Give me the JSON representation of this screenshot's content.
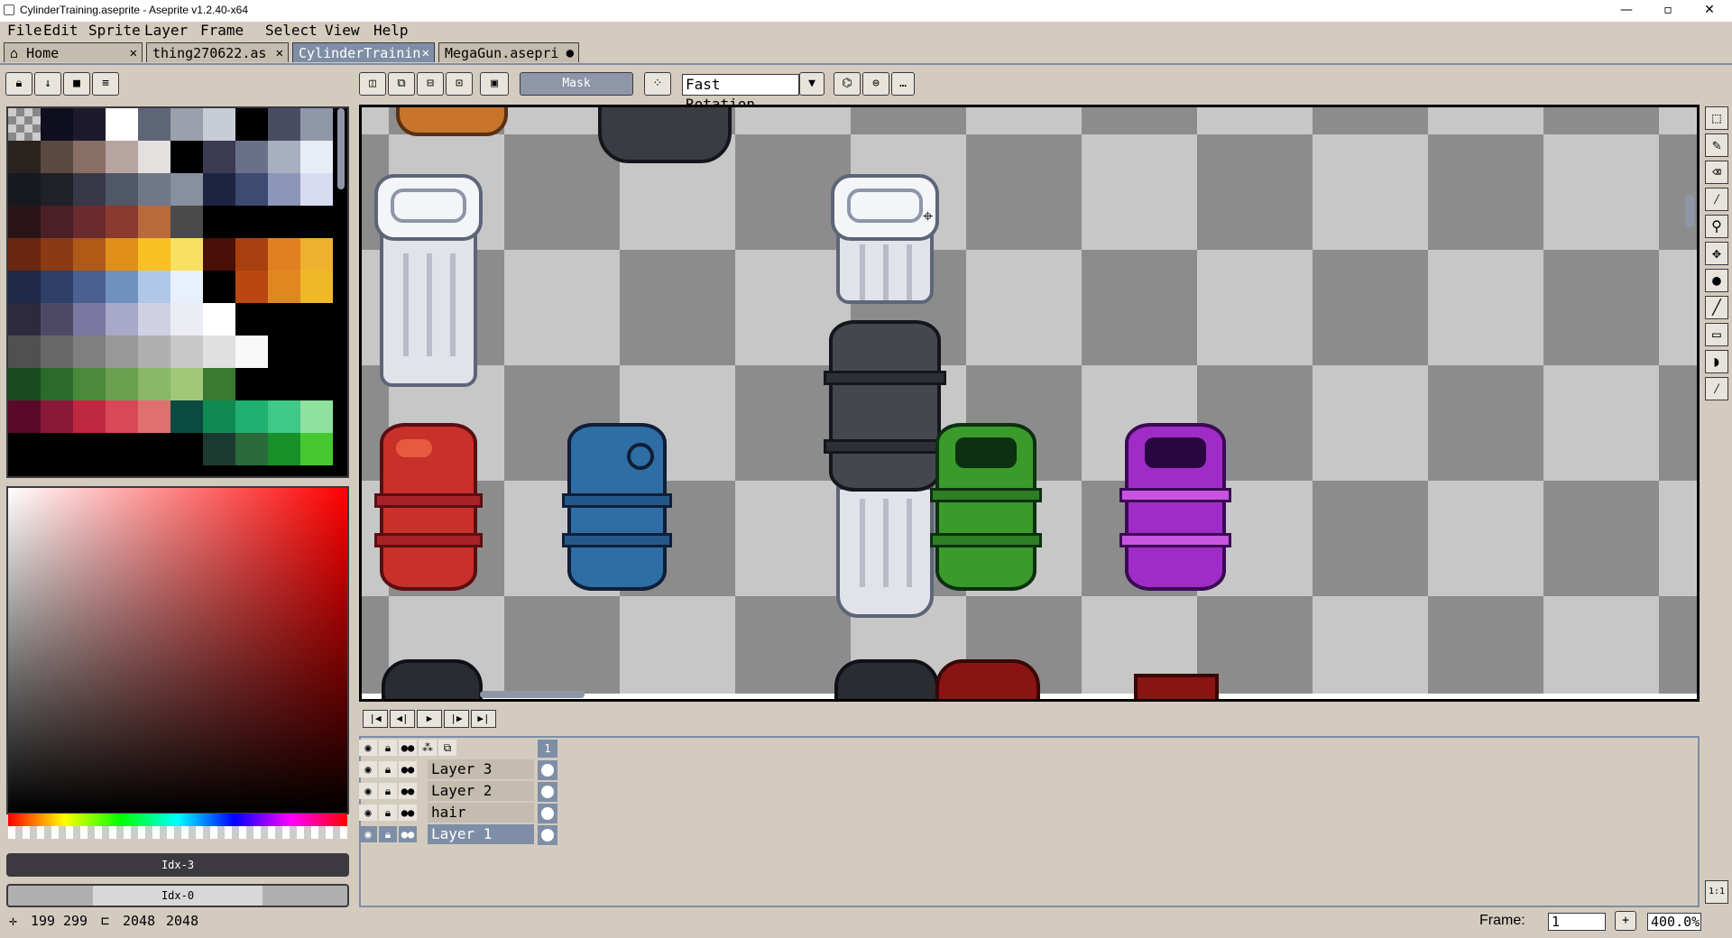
{
  "window": {
    "title": "CylinderTraining.aseprite - Aseprite v1.2.40-x64"
  },
  "menu": [
    "File",
    "Edit",
    "Sprite",
    "Layer",
    "Frame",
    "Select",
    "View",
    "Help"
  ],
  "tabs": [
    {
      "label": "Home",
      "close": "✕"
    },
    {
      "label": "thing270622.as",
      "close": "✕"
    },
    {
      "label": "CylinderTrainin",
      "close": "✕"
    },
    {
      "label": "MegaGun.asepri",
      "close": "●"
    }
  ],
  "context_bar": {
    "mask_label": "Mask",
    "rotation_algorithm": "Fast Rotation"
  },
  "colors": {
    "accent": "#7e8ea6",
    "face": "#d3cbbe",
    "dark": "#3c3a40",
    "palette": [
      "#a0a0a0",
      "#0f0f1e",
      "#1e1a2e",
      "#ffffff",
      "#5d6577",
      "#9aa0ac",
      "#c8ccd6",
      "#000000",
      "#4a4c62",
      "#8e96a8",
      "#2a2320",
      "#5a4a42",
      "#8a6f66",
      "#b8a4a0",
      "#e4e0e0",
      "#000000",
      "#3a3a52",
      "#6a7088",
      "#a8b0c0",
      "#e8ecf4",
      "#181820",
      "#202028",
      "#383848",
      "#505868",
      "#707888",
      "#8890a0",
      "#1e2440",
      "#3e4a70",
      "#8c96b8",
      "#d8dcf0",
      "#2a1418",
      "#4a2026",
      "#6a2a2e",
      "#8a3a2e",
      "#b86a3a",
      "#4a4a4a",
      "#000000",
      "#000000",
      "#000000",
      "#000000",
      "#6a2810",
      "#8a3a14",
      "#b05a18",
      "#e09018",
      "#f8c020",
      "#f8e060",
      "#4a1008",
      "#a84010",
      "#e08020",
      "#f0b030",
      "#1e2a48",
      "#2e4068",
      "#4a6090",
      "#7090c0",
      "#b0c8e8",
      "#e8f0fc",
      "#000000",
      "#b84810",
      "#e08820",
      "#f0b828",
      "#2e2a3e",
      "#4e4a66",
      "#7a78a0",
      "#a8a8c8",
      "#d0d0e4",
      "#ececf4",
      "#ffffff",
      "#000000",
      "#000000",
      "#000000",
      "#505050",
      "#686868",
      "#808080",
      "#989898",
      "#b0b0b0",
      "#c8c8c8",
      "#e0e0e0",
      "#f8f8f8",
      "#000000",
      "#000000",
      "#1a4a20",
      "#2a6a2a",
      "#4a8a3a",
      "#6aa050",
      "#8ab868",
      "#a0c878",
      "#3a7a30",
      "#000000",
      "#000000",
      "#000000",
      "#5a0a28",
      "#8a1838",
      "#c02840",
      "#d84858",
      "#e07070",
      "#0a4a40",
      "#108a50",
      "#20b070",
      "#40c888",
      "#90e0a0",
      "#000000",
      "#000000",
      "#000000",
      "#000000",
      "#000000",
      "#000000",
      "#1a3a30",
      "#2a6a38",
      "#18902a",
      "#48c830"
    ]
  },
  "palette_top_buttons": [
    "lock-icon",
    "down-arrow-icon",
    "square-icon",
    "menu-icon"
  ],
  "fg_color": {
    "label": "Idx-3"
  },
  "bg_color": {
    "label": "Idx-0"
  },
  "status": {
    "cursor_x": "199",
    "cursor_y": "299",
    "size_w": "2048",
    "size_h": "2048"
  },
  "frame_field": {
    "label": "Frame:",
    "value": "1",
    "zoom": "400.0%",
    "add": "+"
  },
  "timeline": {
    "frame_number": "1",
    "layers": [
      {
        "name": "Layer 3",
        "selected": false
      },
      {
        "name": "Layer 2",
        "selected": false
      },
      {
        "name": "hair",
        "selected": false
      },
      {
        "name": "Layer 1",
        "selected": true
      }
    ]
  },
  "tools": [
    "marquee-icon",
    "pencil-icon",
    "eraser-icon",
    "eyedropper-icon",
    "zoom-icon",
    "move-icon",
    "paint-bucket-icon",
    "line-icon",
    "rectangle-icon",
    "contour-icon",
    "blur-icon"
  ],
  "zoom_button": "1:1"
}
